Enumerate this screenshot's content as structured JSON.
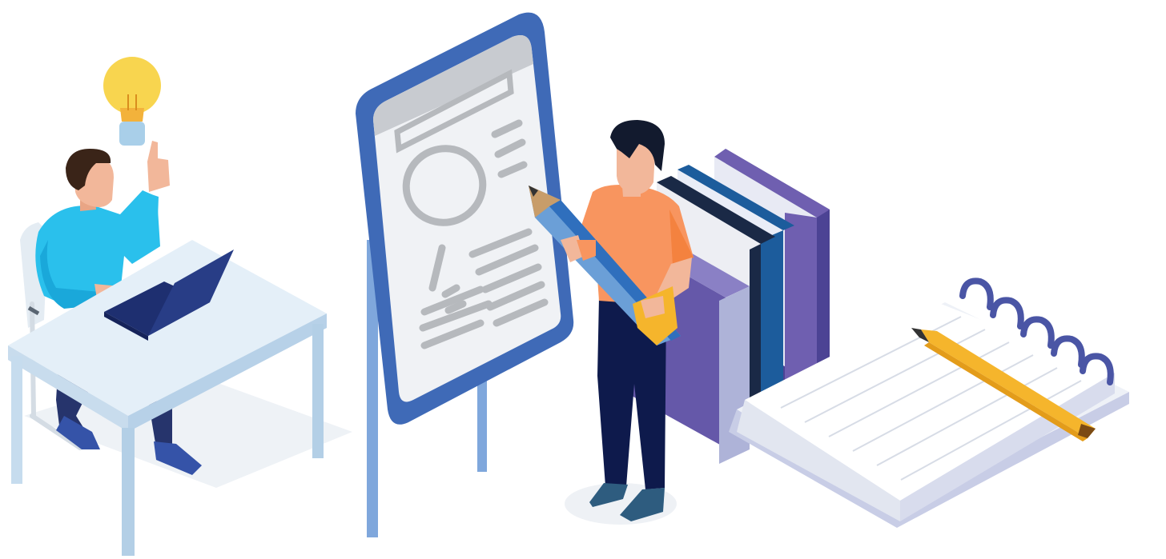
{
  "palette": {
    "shirt_blue": "#35c6ee",
    "hair": "#3a2418",
    "skin": "#f2b79a",
    "desk": "#d9eaf6",
    "laptop": "#283d86",
    "bulb": "#f8d54f",
    "board_frame": "#3f6ab7",
    "board_surface": "#f0f2f5",
    "board_marks": "#b6b9bd",
    "tshirt_orange": "#f8955f",
    "pants_navy": "#0e1a4c",
    "pencil_blue": "#6b9fd7",
    "pencil_yellow": "#f5b52c",
    "book_purple": "#6f5fb0",
    "book_navy": "#1a2946",
    "book_blue": "#1c5c9c",
    "notebook_ring": "#4a55a5"
  }
}
